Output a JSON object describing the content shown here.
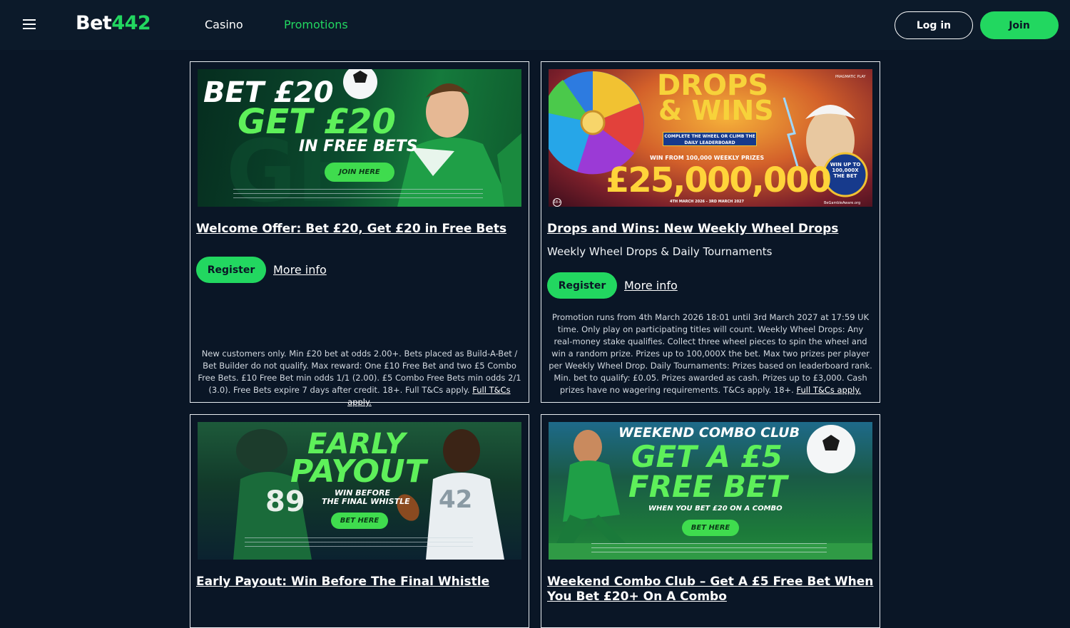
{
  "header": {
    "logo_main": "Bet",
    "logo_num": "442",
    "nav": {
      "casino": "Casino",
      "promotions": "Promotions"
    },
    "login_label": "Log in",
    "join_label": "Join"
  },
  "colors": {
    "brand_green": "#22d760",
    "background": "#0a1626",
    "header": "#0c1a2a"
  },
  "promos": [
    {
      "banner": {
        "line1": "BET £20",
        "line2": "GET £20",
        "line3": "IN FREE BETS",
        "cta": "JOIN HERE"
      },
      "title": "Welcome Offer: Bet £20, Get £20 in Free Bets",
      "register_label": "Register",
      "more_info_label": "More info",
      "terms": "New customers only. Min £20 bet at odds 2.00+. Bets placed as Build-A-Bet / Bet Builder do not qualify. Max reward: One £10 Free Bet and two £5 Combo Free Bets. £10 Free Bet min odds 1/1 (2.00). £5 Combo Free Bets min odds 2/1 (3.0). Free Bets expire 7 days after credit. 18+. Full T&Cs apply.",
      "terms_link": "Full T&Cs apply."
    },
    {
      "banner": {
        "line1": "DROPS",
        "line2": "& WINS",
        "ribbon": "COMPLETE THE WHEEL OR CLIMB THE DAILY LEADERBOARD",
        "weekly": "WIN FROM 100,000 WEEKLY PRIZES",
        "amount": "£25,000,000",
        "badge": "WIN UP TO 100,000X THE BET",
        "dates": "4TH MARCH 2026 - 3RD MARCH 2027",
        "provider": "PRAGMATIC PLAY",
        "age": "18+",
        "footer": "BeGambleAware.org"
      },
      "title": "Drops and Wins: New Weekly Wheel Drops",
      "subtitle": "Weekly Wheel Drops & Daily Tournaments",
      "register_label": "Register",
      "more_info_label": "More info",
      "terms": "Promotion runs from 4th March 2026 18:01 until 3rd March 2027 at 17:59 UK time. Only play on participating titles will count. Weekly Wheel Drops: Any real-money stake qualifies. Collect three wheel pieces to spin the wheel and win a random prize. Prizes up to 100,000X the bet. Max two prizes per player per Weekly Wheel Drop. Daily Tournaments: Prizes based on leaderboard rank. Min. bet to qualify: £0.05. Prizes awarded as cash. Prizes up to £3,000. Cash prizes have no wagering requirements. T&Cs apply. 18+.",
      "terms_link": "Full T&Cs apply."
    },
    {
      "banner": {
        "line1": "EARLY",
        "line2": "PAYOUT",
        "line3": "WIN BEFORE",
        "line4": "THE FINAL WHISTLE",
        "cta": "BET HERE"
      },
      "title": "Early Payout: Win Before The Final Whistle"
    },
    {
      "banner": {
        "line1": "WEEKEND COMBO CLUB",
        "line2": "GET A £5",
        "line3": "FREE BET",
        "line4": "WHEN YOU BET £20 ON A COMBO",
        "cta": "BET HERE"
      },
      "title": "Weekend Combo Club – Get A £5 Free Bet When You Bet £20+ On A Combo"
    }
  ]
}
